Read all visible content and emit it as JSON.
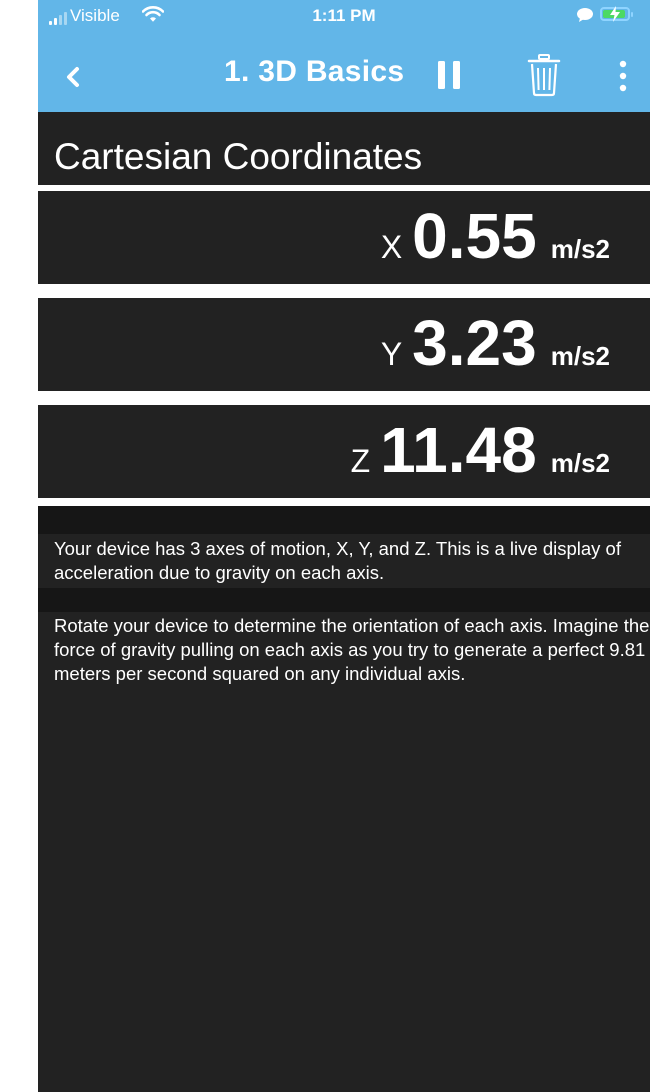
{
  "status_bar": {
    "carrier": "Visible",
    "time": "1:11 PM",
    "icons": [
      "signal-icon",
      "wifi-icon",
      "message-icon",
      "battery-charging-icon"
    ]
  },
  "app_bar": {
    "title": "1. 3D Basics",
    "back_icon": "chevron-left-icon",
    "pause_icon": "pause-icon",
    "trash_icon": "trash-icon",
    "menu_icon": "more-vertical-icon",
    "color": "#62b6e8"
  },
  "section": {
    "title": "Cartesian Coordinates"
  },
  "axes": [
    {
      "label": "X",
      "value": "0.55",
      "unit": "m/s2"
    },
    {
      "label": "Y",
      "value": "3.23",
      "unit": "m/s2"
    },
    {
      "label": "Z",
      "value": "11.48",
      "unit": "m/s2"
    }
  ],
  "description": {
    "paragraph1": "Your device has 3 axes of motion, X, Y, and Z.  This is a live display of acceleration due to gravity on each axis.",
    "paragraph2": "Rotate your device to determine the orientation of each axis.  Imagine the force of gravity pulling on each axis as you try to generate a perfect 9.81 meters per second squared on any individual axis."
  },
  "colors": {
    "background": "#222222",
    "text": "#ffffff",
    "battery": "#4cd964"
  }
}
